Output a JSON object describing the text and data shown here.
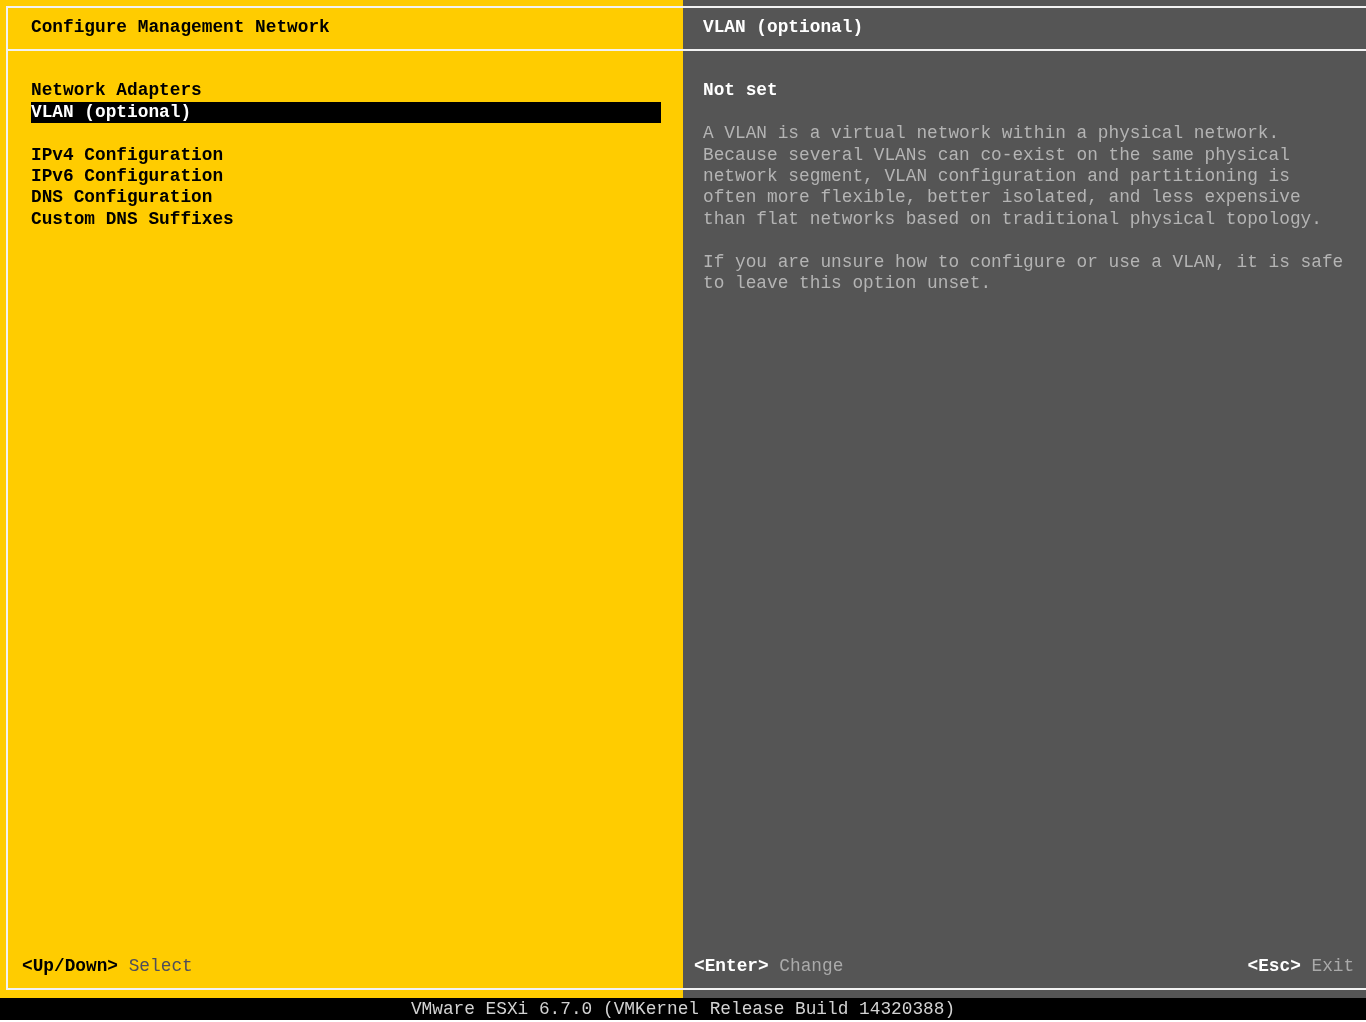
{
  "left_panel": {
    "title": "Configure Management Network",
    "menu_groups": [
      {
        "items": [
          {
            "label": "Network Adapters",
            "selected": false
          },
          {
            "label": "VLAN (optional)",
            "selected": true
          }
        ]
      },
      {
        "items": [
          {
            "label": "IPv4 Configuration",
            "selected": false
          },
          {
            "label": "IPv6 Configuration",
            "selected": false
          },
          {
            "label": "DNS Configuration",
            "selected": false
          },
          {
            "label": "Custom DNS Suffixes",
            "selected": false
          }
        ]
      }
    ],
    "footer_hints": [
      {
        "key": "<Up/Down>",
        "action": "Select"
      }
    ]
  },
  "right_panel": {
    "title": "VLAN (optional)",
    "value": "Not set",
    "paragraphs": [
      "A VLAN is a virtual network within a physical network. Because several VLANs can co-exist on the same physical network segment, VLAN configuration and partitioning is often more flexible, better isolated, and less expensive than flat networks based on traditional physical topology.",
      "If you are unsure how to configure or use a VLAN, it is safe to leave this option unset."
    ],
    "footer_hints": [
      {
        "key": "<Enter>",
        "action": "Change"
      },
      {
        "key": "<Esc>",
        "action": "Exit"
      }
    ]
  },
  "status_bar": {
    "text": "VMware ESXi 6.7.0 (VMKernel Release Build 14320388)"
  }
}
